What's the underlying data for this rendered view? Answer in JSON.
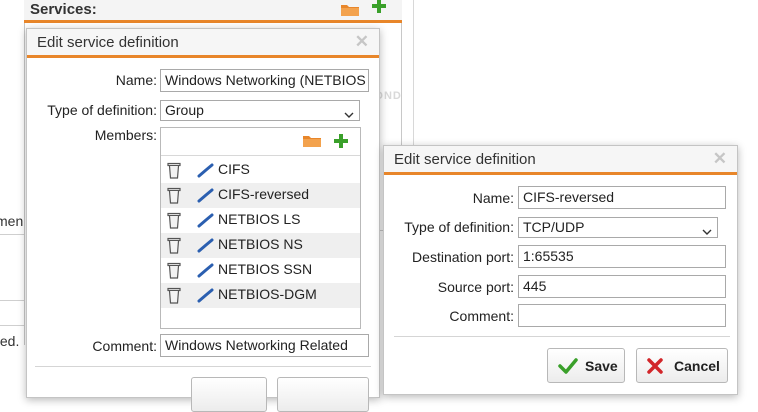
{
  "background": {
    "services_title": "Services:",
    "left_text_1": "men",
    "left_text_2": "ted.",
    "dnd_text": "DND",
    "icons": [
      "folder-icon",
      "plus-icon"
    ]
  },
  "dialog_group": {
    "title": "Edit service definition",
    "labels": {
      "name": "Name:",
      "type": "Type of definition:",
      "members": "Members:",
      "comment": "Comment:"
    },
    "values": {
      "name": "Windows Networking (NETBIOS",
      "type": "Group",
      "comment": "Windows Networking Related"
    },
    "members": [
      {
        "label": "CIFS"
      },
      {
        "label": "CIFS-reversed"
      },
      {
        "label": "NETBIOS LS"
      },
      {
        "label": "NETBIOS NS"
      },
      {
        "label": "NETBIOS SSN"
      },
      {
        "label": "NETBIOS-DGM"
      }
    ]
  },
  "dialog_service": {
    "title": "Edit service definition",
    "labels": {
      "name": "Name:",
      "type": "Type of definition:",
      "destination_port": "Destination port:",
      "source_port": "Source port:",
      "comment": "Comment:"
    },
    "values": {
      "name": "CIFS-reversed",
      "type": "TCP/UDP",
      "destination_port": "1:65535",
      "source_port": "445",
      "comment": ""
    },
    "buttons": {
      "save": "Save",
      "cancel": "Cancel"
    }
  },
  "colors": {
    "accent": "#e8862a",
    "plus": "#3aa02a",
    "link_icon": "#2b5fb0",
    "cancel_x": "#d2262a"
  }
}
